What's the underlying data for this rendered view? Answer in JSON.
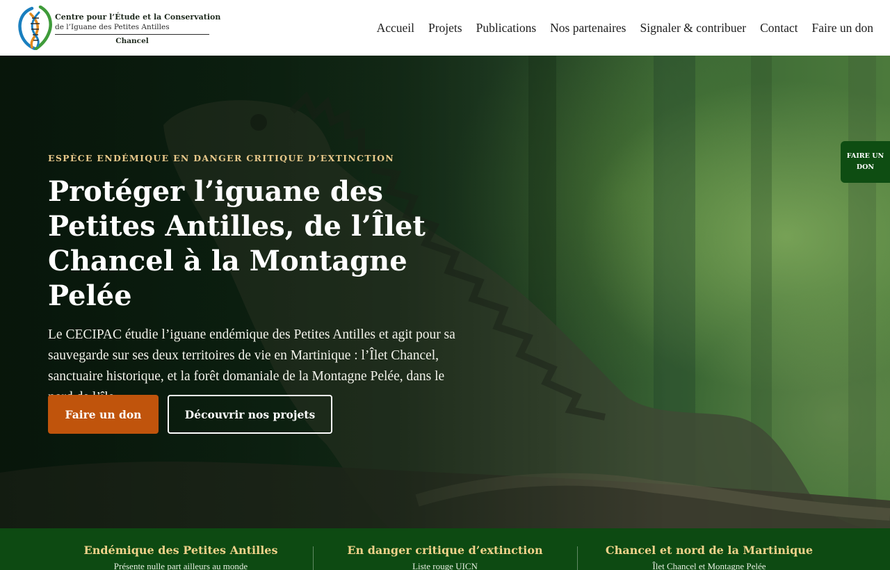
{
  "header": {
    "logo": {
      "line1": "Centre pour l’Étude et la Conservation",
      "line2": "de l’Iguane des Petites Antilles",
      "line3": "Chancel"
    },
    "nav": [
      {
        "label": "Accueil"
      },
      {
        "label": "Projets"
      },
      {
        "label": "Publications"
      },
      {
        "label": "Nos partenaires"
      },
      {
        "label": "Signaler & contribuer"
      },
      {
        "label": "Contact"
      },
      {
        "label": "Faire un don"
      }
    ]
  },
  "hero": {
    "eyebrow": "ESPÈCE ENDÉMIQUE EN DANGER CRITIQUE D’EXTINCTION",
    "title": "Protéger l’iguane des Petites Antilles, de l’Îlet Chancel à la Montagne Pelée",
    "lead": "Le CECIPAC étudie l’iguane endémique des Petites Antilles et agit pour sa sauvegarde sur ses deux territoires de vie en Martinique : l’Îlet Chancel, sanctuaire historique, et la forêt domaniale de la Montagne Pelée, dans le nord de l’île.",
    "primary_button": "Faire un don",
    "secondary_button": "Découvrir nos projets"
  },
  "side_donate": {
    "label": "FAIRE UN DON"
  },
  "stats": [
    {
      "title": "Endémique des Petites Antilles",
      "subtitle": "Présente nulle part ailleurs au monde"
    },
    {
      "title": "En danger critique d’extinction",
      "subtitle": "Liste rouge UICN"
    },
    {
      "title": "Chancel et nord de la Martinique",
      "subtitle": "Îlet Chancel et Montagne Pelée"
    }
  ],
  "colors": {
    "accent_orange": "#c0540c",
    "forest_green": "#0d4a12",
    "eyebrow_gold": "#e8c88a",
    "stat_gold": "#f0d28a"
  },
  "icons": {
    "logo": "dna-helix-logo-icon"
  }
}
